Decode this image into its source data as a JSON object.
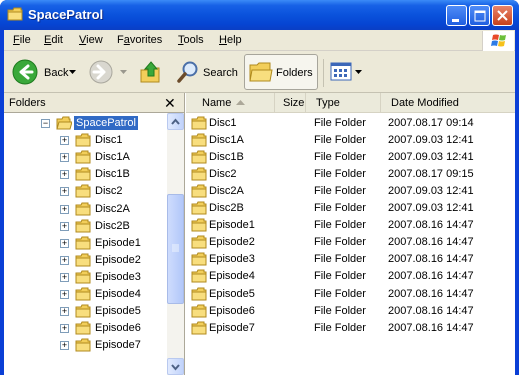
{
  "window": {
    "title": "SpacePatrol"
  },
  "menu": [
    {
      "label": "File",
      "u": "F",
      "rest": "ile"
    },
    {
      "label": "Edit",
      "u": "E",
      "rest": "dit"
    },
    {
      "label": "View",
      "u": "V",
      "rest": "iew"
    },
    {
      "label": "Favorites",
      "u": "a",
      "pre": "F",
      "rest": "vorites"
    },
    {
      "label": "Tools",
      "u": "T",
      "rest": "ools"
    },
    {
      "label": "Help",
      "u": "H",
      "rest": "elp"
    }
  ],
  "toolbar": {
    "back_label": "Back",
    "search_label": "Search",
    "folders_label": "Folders"
  },
  "tree": {
    "header": "Folders",
    "close_symbol": "✕",
    "root": "SpacePatrol",
    "children": [
      "Disc1",
      "Disc1A",
      "Disc1B",
      "Disc2",
      "Disc2A",
      "Disc2B",
      "Episode1",
      "Episode2",
      "Episode3",
      "Episode4",
      "Episode5",
      "Episode6",
      "Episode7"
    ]
  },
  "list": {
    "columns": [
      "Name",
      "Size",
      "Type",
      "Date Modified"
    ],
    "rows": [
      {
        "name": "Disc1",
        "type": "File Folder",
        "date": "2007.08.17 09:14"
      },
      {
        "name": "Disc1A",
        "type": "File Folder",
        "date": "2007.09.03 12:41"
      },
      {
        "name": "Disc1B",
        "type": "File Folder",
        "date": "2007.09.03 12:41"
      },
      {
        "name": "Disc2",
        "type": "File Folder",
        "date": "2007.08.17 09:15"
      },
      {
        "name": "Disc2A",
        "type": "File Folder",
        "date": "2007.09.03 12:41"
      },
      {
        "name": "Disc2B",
        "type": "File Folder",
        "date": "2007.09.03 12:41"
      },
      {
        "name": "Episode1",
        "type": "File Folder",
        "date": "2007.08.16 14:47"
      },
      {
        "name": "Episode2",
        "type": "File Folder",
        "date": "2007.08.16 14:47"
      },
      {
        "name": "Episode3",
        "type": "File Folder",
        "date": "2007.08.16 14:47"
      },
      {
        "name": "Episode4",
        "type": "File Folder",
        "date": "2007.08.16 14:47"
      },
      {
        "name": "Episode5",
        "type": "File Folder",
        "date": "2007.08.16 14:47"
      },
      {
        "name": "Episode6",
        "type": "File Folder",
        "date": "2007.08.16 14:47"
      },
      {
        "name": "Episode7",
        "type": "File Folder",
        "date": "2007.08.16 14:47"
      }
    ]
  },
  "colors": {
    "titlebar": "#0A52DC",
    "selection": "#316AC5",
    "folder": "#F2CE5A"
  }
}
